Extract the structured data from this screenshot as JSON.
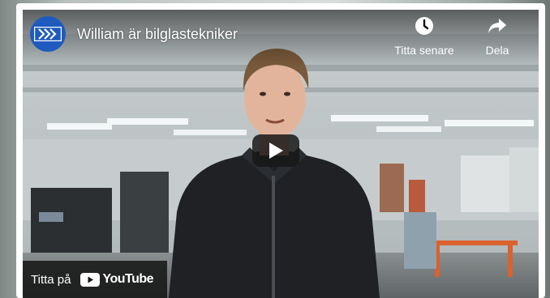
{
  "video": {
    "title": "William är bilglastekniker",
    "watch_later_label": "Titta senare",
    "share_label": "Dela",
    "watch_on_label": "Titta på",
    "youtube_wordmark": "YouTube"
  },
  "icons": {
    "channel_logo": "channel-logo-icon",
    "watch_later": "clock-icon",
    "share": "share-arrow-icon",
    "play": "play-icon",
    "youtube": "youtube-logo-icon"
  },
  "colors": {
    "channel_logo_bg": "#1f5bbf",
    "overlay_text": "#ffffff",
    "youtube_red_in_logo": "#ffffff",
    "player_bg": "#0b0b0b"
  }
}
